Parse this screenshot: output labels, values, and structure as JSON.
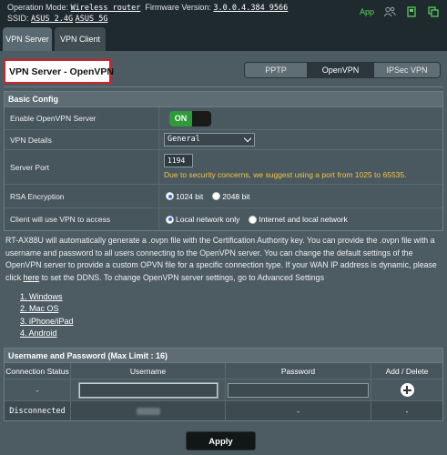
{
  "header": {
    "operation_mode_label": "Operation Mode:",
    "operation_mode_value": "Wireless router",
    "firmware_label": "Firmware Version:",
    "firmware_value": "3.0.0.4.384_9566",
    "ssid_label": "SSID:",
    "ssid_values": [
      "ASUS_2.4G",
      "ASUS_5G"
    ],
    "app_label": "App",
    "icons": [
      "people-icon",
      "usb-icon",
      "copy-icon"
    ],
    "accent_color": "#5cd65c"
  },
  "tabs": [
    {
      "label": "VPN Server",
      "active": true
    },
    {
      "label": "VPN Client",
      "active": false
    }
  ],
  "page_title": "VPN Server - OpenVPN",
  "vpn_type_tabs": [
    {
      "label": "PPTP",
      "selected": false
    },
    {
      "label": "OpenVPN",
      "selected": true
    },
    {
      "label": "IPSec VPN",
      "selected": false
    }
  ],
  "basic_config": {
    "header": "Basic Config",
    "enable_label": "Enable OpenVPN Server",
    "enable_state": "ON",
    "details_label": "VPN Details",
    "details_value": "General",
    "port_label": "Server Port",
    "port_value": "1194",
    "port_hint": "Due to security concerns, we suggest using a port from 1025 to 65535.",
    "rsa_label": "RSA Encryption",
    "rsa_options": [
      "1024 bit",
      "2048 bit"
    ],
    "rsa_selected": "1024 bit",
    "access_label": "Client will use VPN to access",
    "access_options": [
      "Local network only",
      "Internet and local network"
    ],
    "access_selected": "Local network only"
  },
  "description": {
    "part1": "RT-AX88U will automatically generate a .ovpn file with the Certification Authority key. You can provide the .ovpn file with a username and password to all users connecting to the OpenVPN server. You can change the default settings of the OpenVPN server to provide a custom OPVN file for a specific connection type. If your WAN IP address is dynamic, please click ",
    "link": "here",
    "part2": " to set the DDNS. To change OpenVPN server settings, go to Advanced Settings"
  },
  "os_list": [
    "1. Windows",
    "2. Mac OS",
    "3. iPhone/iPad",
    "4. Android"
  ],
  "users": {
    "header": "Username and Password (Max Limit : 16)",
    "columns": [
      "Connection Status",
      "Username",
      "Password",
      "Add / Delete"
    ],
    "input_row_status": "-",
    "rows": [
      {
        "status": "Disconnected",
        "password": "-",
        "action": "-"
      }
    ]
  },
  "apply_label": "Apply"
}
